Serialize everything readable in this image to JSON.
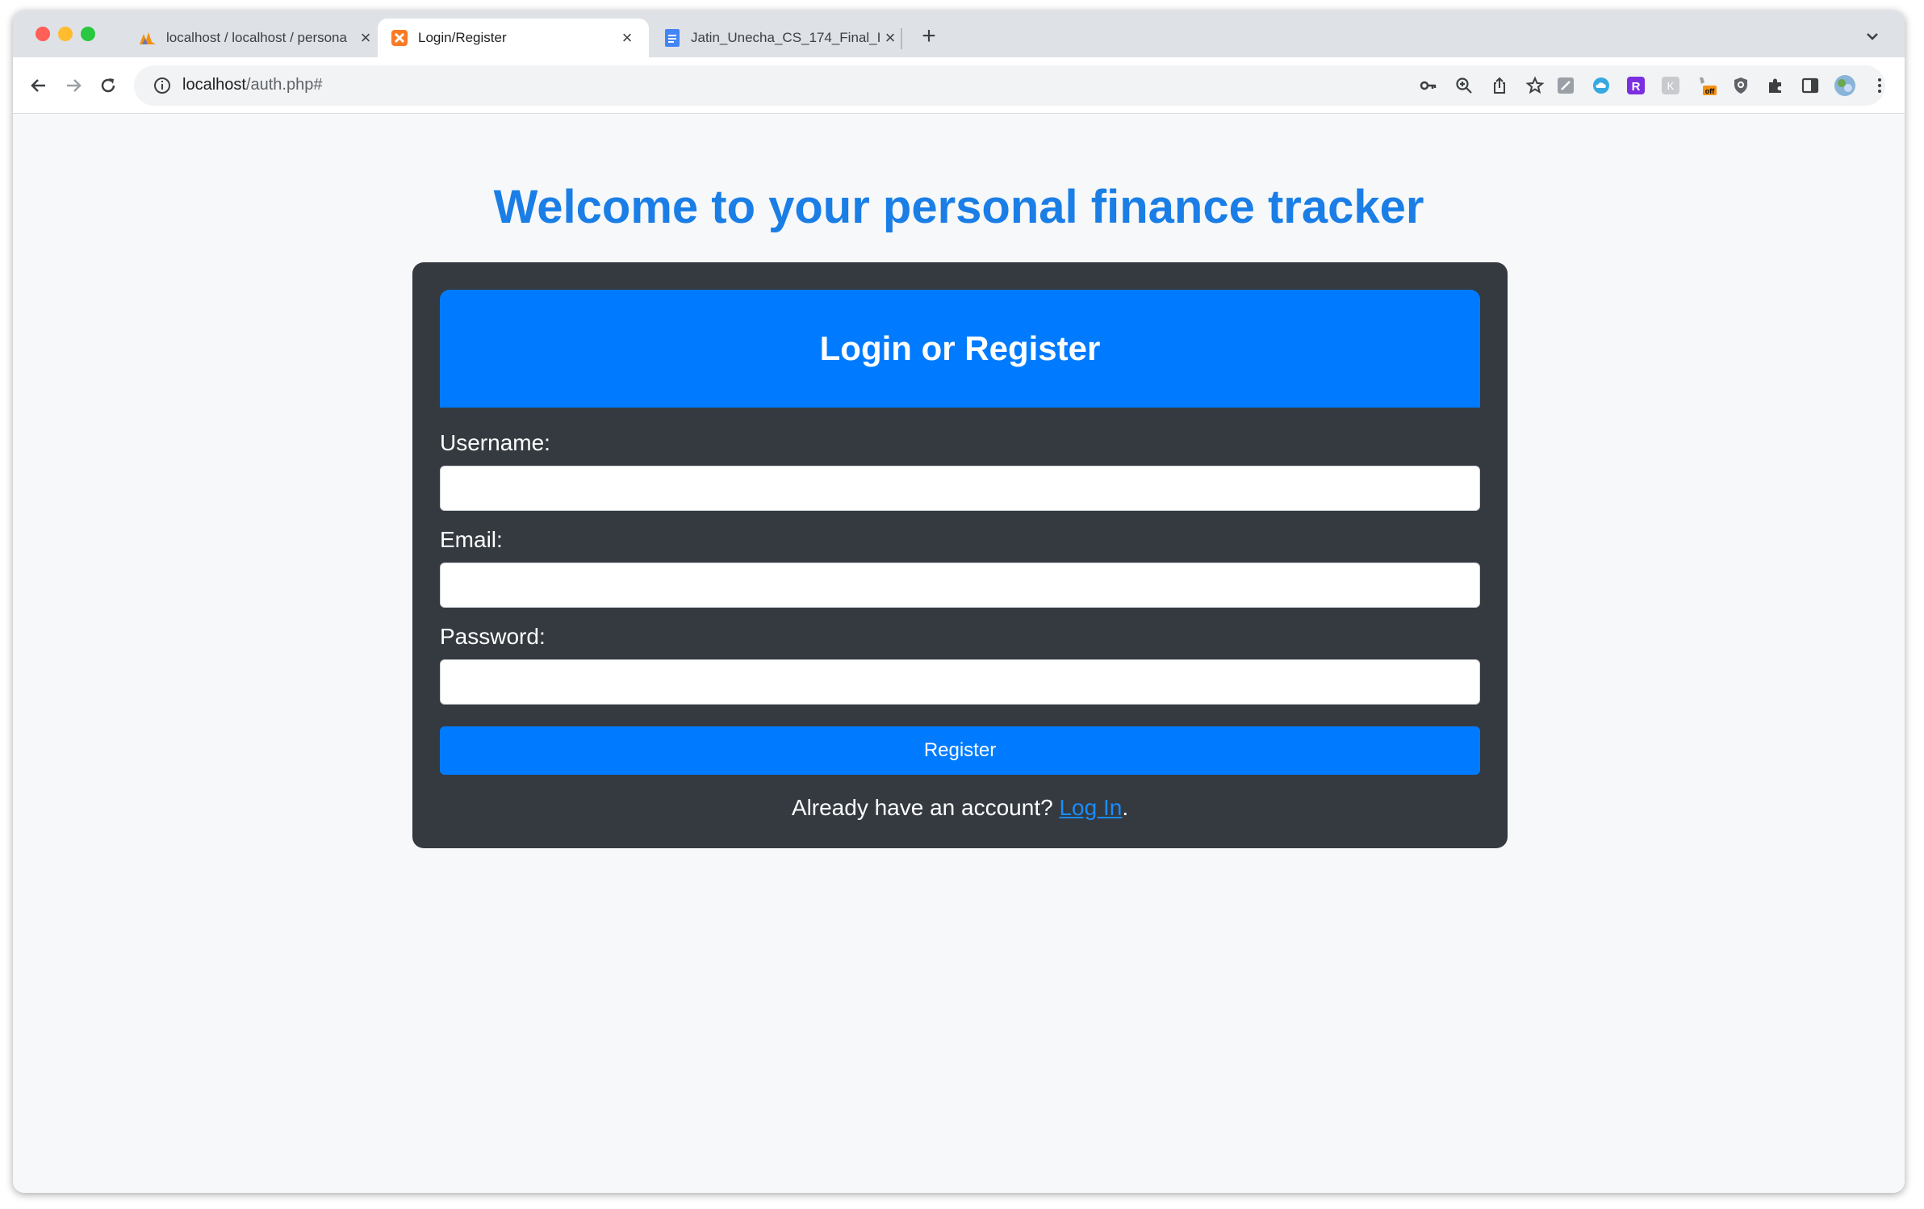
{
  "browser": {
    "tabs": [
      {
        "title": "localhost / localhost / persona",
        "favicon": "phpmyadmin-icon",
        "active": false
      },
      {
        "title": "Login/Register",
        "favicon": "xampp-icon",
        "active": true
      },
      {
        "title": "Jatin_Unecha_CS_174_Final_I",
        "favicon": "google-docs-icon",
        "active": false
      }
    ],
    "url_host": "localhost",
    "url_path": "/auth.php#"
  },
  "page": {
    "heading": "Welcome to your personal finance tracker",
    "card_title": "Login or Register",
    "username_label": "Username:",
    "email_label": "Email:",
    "password_label": "Password:",
    "username_value": "",
    "email_value": "",
    "password_value": "",
    "submit_label": "Register",
    "footer_prefix": "Already have an account?",
    "footer_link": "Log In",
    "footer_suffix": "."
  },
  "colors": {
    "accent": "#007bff",
    "heading": "#1a7ee6",
    "card_bg": "#343a40",
    "page_bg": "#f7f8f9"
  }
}
